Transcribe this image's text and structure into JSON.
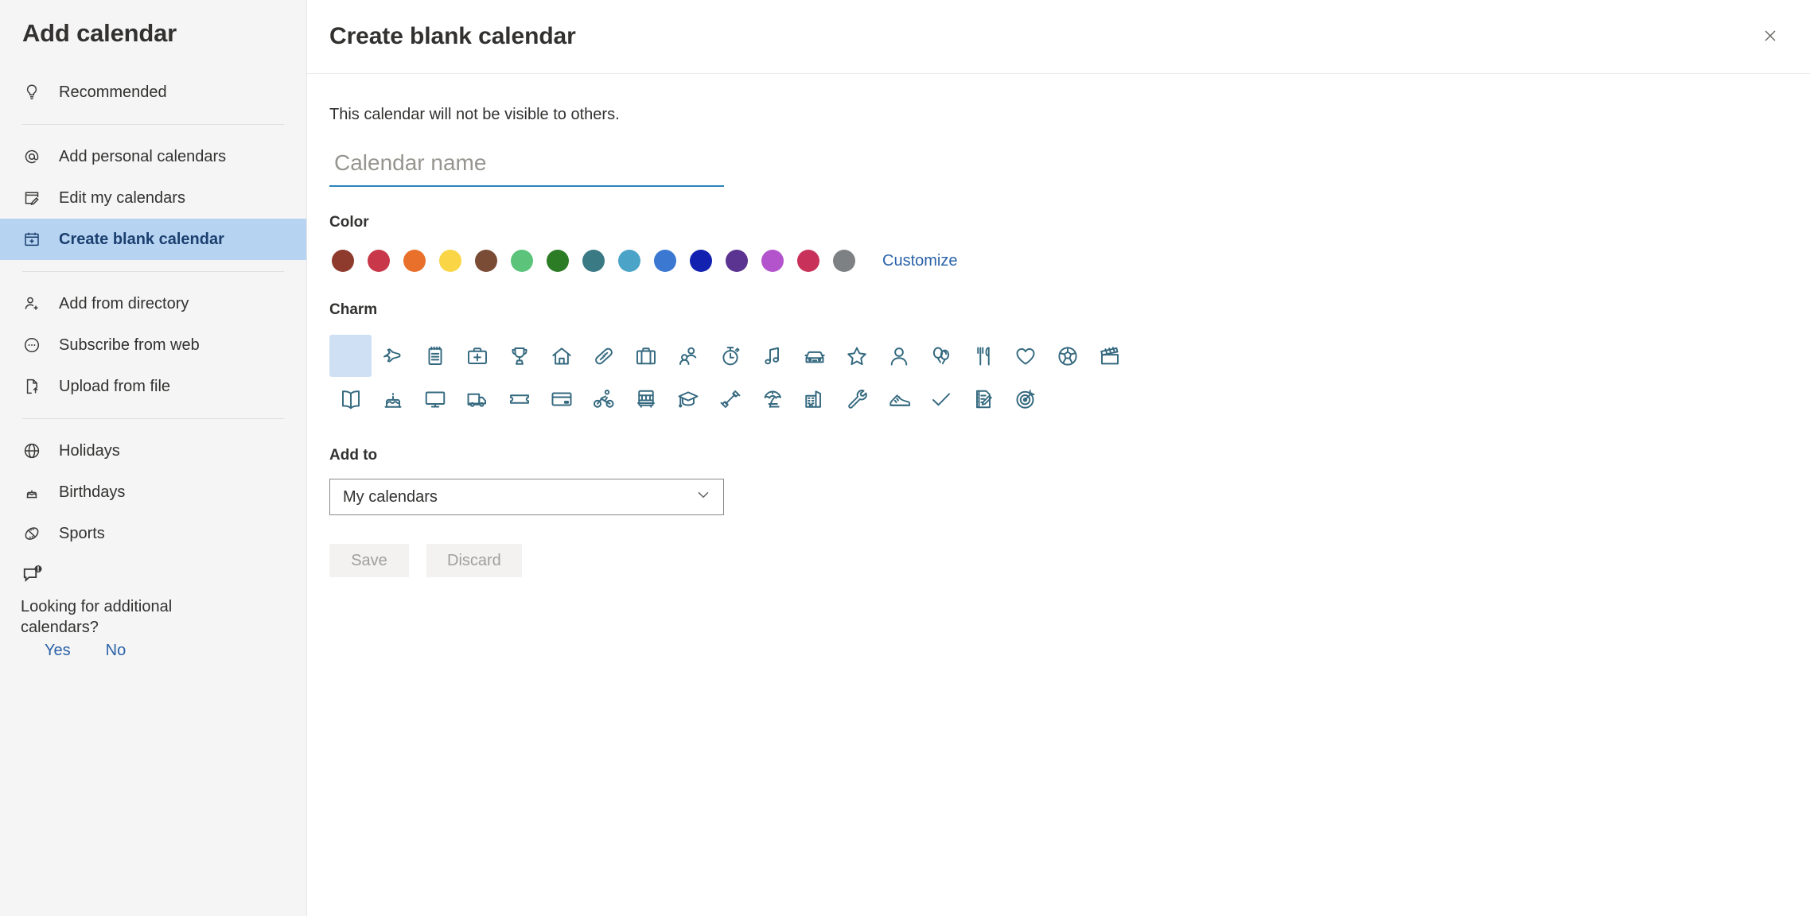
{
  "sidebar": {
    "title": "Add calendar",
    "groups": [
      {
        "items": [
          {
            "label": "Recommended",
            "icon": "lightbulb-icon",
            "selected": false
          }
        ]
      },
      {
        "items": [
          {
            "label": "Add personal calendars",
            "icon": "at-sign-icon",
            "selected": false
          },
          {
            "label": "Edit my calendars",
            "icon": "edit-calendar-icon",
            "selected": false
          },
          {
            "label": "Create blank calendar",
            "icon": "calendar-plus-icon",
            "selected": true
          }
        ]
      },
      {
        "items": [
          {
            "label": "Add from directory",
            "icon": "person-add-icon",
            "selected": false
          },
          {
            "label": "Subscribe from web",
            "icon": "subscribe-icon",
            "selected": false
          },
          {
            "label": "Upload from file",
            "icon": "file-upload-icon",
            "selected": false
          }
        ]
      },
      {
        "items": [
          {
            "label": "Holidays",
            "icon": "globe-icon",
            "selected": false
          },
          {
            "label": "Birthdays",
            "icon": "cake-icon",
            "selected": false
          },
          {
            "label": "Sports",
            "icon": "sports-ball-icon",
            "selected": false
          }
        ]
      }
    ],
    "feedback": {
      "icon": "feedback-alert-icon",
      "question": "Looking for additional calendars?",
      "yes_label": "Yes",
      "no_label": "No"
    }
  },
  "header": {
    "title": "Create blank calendar",
    "close_icon": "close-icon"
  },
  "main": {
    "subtitle": "This calendar will not be visible to others.",
    "name_field": {
      "value": "",
      "placeholder": "Calendar name"
    },
    "color_label": "Color",
    "customize_label": "Customize",
    "charm_label": "Charm",
    "addto_label": "Add to",
    "addto_value": "My calendars",
    "addto_chevron_icon": "chevron-down-icon",
    "save_label": "Save",
    "discard_label": "Discard"
  },
  "colors": [
    {
      "name": "dark-red-brown",
      "hex": "#8e3a2c"
    },
    {
      "name": "cranberry",
      "hex": "#c8374a"
    },
    {
      "name": "orange",
      "hex": "#e8702a"
    },
    {
      "name": "yellow",
      "hex": "#fad546"
    },
    {
      "name": "brown",
      "hex": "#7a4b35"
    },
    {
      "name": "light-green",
      "hex": "#5bc47a"
    },
    {
      "name": "green",
      "hex": "#2b7c24"
    },
    {
      "name": "teal-dark",
      "hex": "#3a7a85"
    },
    {
      "name": "light-blue",
      "hex": "#4ba3c7"
    },
    {
      "name": "blue",
      "hex": "#3a78d1"
    },
    {
      "name": "dark-blue",
      "hex": "#1221b0"
    },
    {
      "name": "dark-purple",
      "hex": "#5b3391"
    },
    {
      "name": "light-purple",
      "hex": "#b454cd"
    },
    {
      "name": "pink-red",
      "hex": "#c8315a"
    },
    {
      "name": "gray",
      "hex": "#7e8184"
    }
  ],
  "selected_color_index": -1,
  "charms": [
    {
      "name": "none-charm",
      "selected": true
    },
    {
      "name": "airplane-charm",
      "selected": false
    },
    {
      "name": "notepad-charm",
      "selected": false
    },
    {
      "name": "first-aid-kit-charm",
      "selected": false
    },
    {
      "name": "trophy-charm",
      "selected": false
    },
    {
      "name": "home-charm",
      "selected": false
    },
    {
      "name": "bandage-charm",
      "selected": false
    },
    {
      "name": "briefcase-charm",
      "selected": false
    },
    {
      "name": "people-charm",
      "selected": false
    },
    {
      "name": "stopwatch-charm",
      "selected": false
    },
    {
      "name": "music-note-charm",
      "selected": false
    },
    {
      "name": "car-charm",
      "selected": false
    },
    {
      "name": "star-charm",
      "selected": false
    },
    {
      "name": "person-charm",
      "selected": false
    },
    {
      "name": "balloons-charm",
      "selected": false
    },
    {
      "name": "fork-knife-charm",
      "selected": false
    },
    {
      "name": "heart-charm",
      "selected": false
    },
    {
      "name": "soccer-ball-charm",
      "selected": false
    },
    {
      "name": "clapperboard-charm",
      "selected": false
    },
    {
      "name": "book-charm",
      "selected": false
    },
    {
      "name": "birthday-cake-charm",
      "selected": false
    },
    {
      "name": "monitor-charm",
      "selected": false
    },
    {
      "name": "truck-charm",
      "selected": false
    },
    {
      "name": "ticket-charm",
      "selected": false
    },
    {
      "name": "credit-card-charm",
      "selected": false
    },
    {
      "name": "cyclist-charm",
      "selected": false
    },
    {
      "name": "bus-charm",
      "selected": false
    },
    {
      "name": "graduation-cap-charm",
      "selected": false
    },
    {
      "name": "dumbbell-charm",
      "selected": false
    },
    {
      "name": "beach-umbrella-charm",
      "selected": false
    },
    {
      "name": "office-building-charm",
      "selected": false
    },
    {
      "name": "wrench-charm",
      "selected": false
    },
    {
      "name": "sneaker-charm",
      "selected": false
    },
    {
      "name": "checkmark-charm",
      "selected": false
    },
    {
      "name": "note-edit-charm",
      "selected": false
    },
    {
      "name": "target-charm",
      "selected": false
    }
  ]
}
